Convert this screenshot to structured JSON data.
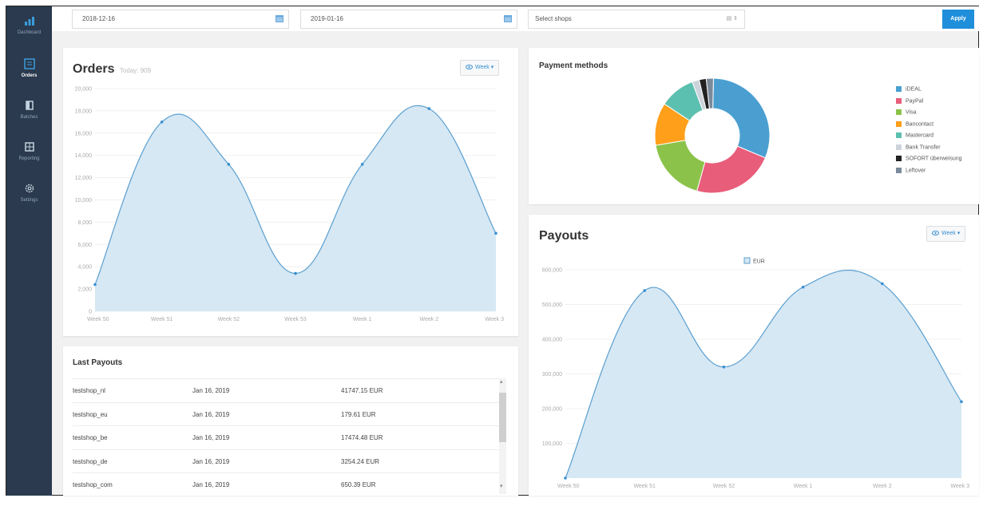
{
  "sidebar": {
    "items": [
      {
        "label": "Dashboard",
        "icon": "bar-chart-icon"
      },
      {
        "label": "Orders",
        "icon": "orders-icon"
      },
      {
        "label": "Batches",
        "icon": "batches-icon"
      },
      {
        "label": "Reporting",
        "icon": "reporting-icon"
      },
      {
        "label": "Settings",
        "icon": "gear-icon"
      }
    ]
  },
  "filters": {
    "date_from": "2018-12-16",
    "date_to": "2019-01-16",
    "shops_placeholder": "Select shops",
    "apply_label": "Apply"
  },
  "orders": {
    "title": "Orders",
    "today_label": "Today: 909",
    "period_label": "Week",
    "chart_data": {
      "type": "area",
      "categories": [
        "Week 50",
        "Week 51",
        "Week 52",
        "Week 53",
        "Week 1",
        "Week 2",
        "Week 3"
      ],
      "values": [
        2400,
        17000,
        13200,
        3400,
        13200,
        18200,
        7000
      ],
      "ylim": [
        0,
        20000
      ],
      "yticks": [
        "0",
        "2,000",
        "4,000",
        "6,000",
        "8,000",
        "10,000",
        "12,000",
        "14,000",
        "16,000",
        "18,000",
        "20,000"
      ]
    }
  },
  "payment_methods": {
    "title": "Payment methods",
    "chart_data": {
      "type": "pie",
      "labels": [
        "iDEAL",
        "PayPal",
        "Visa",
        "Bancontact",
        "Mastercard",
        "Bank Transfer",
        "SOFORT überweisung",
        "Leftover"
      ],
      "values": [
        31,
        23,
        18,
        12,
        10,
        2,
        2,
        2
      ],
      "colors": [
        "#4a9fd0",
        "#e85d7a",
        "#8bc34a",
        "#ff9f1a",
        "#5cc0b0",
        "#cdd3da",
        "#222222",
        "#7a8a9a"
      ]
    }
  },
  "payouts": {
    "title": "Payouts",
    "period_label": "Week",
    "chart_data": {
      "type": "area",
      "categories": [
        "Week 50",
        "Week 51",
        "Week 52",
        "Week 1",
        "Week 2",
        "Week 3"
      ],
      "series": [
        {
          "name": "EUR",
          "values": [
            0,
            540000,
            320000,
            550000,
            560000,
            220000
          ]
        }
      ],
      "ylim": [
        0,
        600000
      ],
      "yticks": [
        "100,000",
        "200,000",
        "300,000",
        "400,000",
        "500,000",
        "600,000"
      ]
    }
  },
  "last_payouts": {
    "title": "Last Payouts",
    "rows": [
      {
        "shop": "testshop_nl",
        "date": "Jan 16, 2019",
        "amount": "41747.15 EUR"
      },
      {
        "shop": "testshop_eu",
        "date": "Jan 16, 2019",
        "amount": "179.61 EUR"
      },
      {
        "shop": "testshop_be",
        "date": "Jan 16, 2019",
        "amount": "17474.48 EUR"
      },
      {
        "shop": "testshop_de",
        "date": "Jan 16, 2019",
        "amount": "3254.24 EUR"
      },
      {
        "shop": "testshop_com",
        "date": "Jan 16, 2019",
        "amount": "650.39 EUR"
      }
    ]
  }
}
